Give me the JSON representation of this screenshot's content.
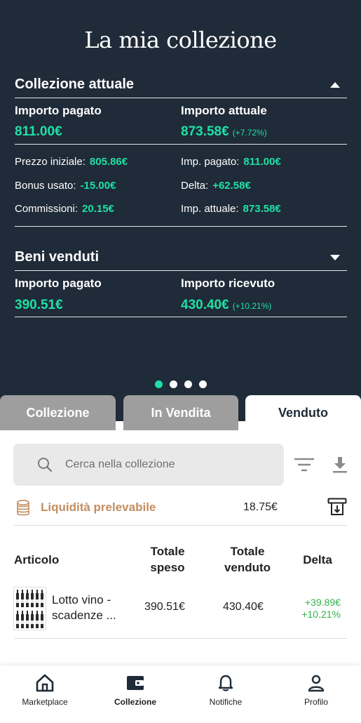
{
  "header": {
    "title": "La mia collezione"
  },
  "collezione_attuale": {
    "title": "Collezione attuale",
    "importo_pagato_label": "Importo pagato",
    "importo_pagato_value": "811.00€",
    "importo_attuale_label": "Importo attuale",
    "importo_attuale_value": "873.58€",
    "importo_attuale_pct": "(+7.72%)",
    "details": {
      "prezzo_iniziale_label": "Prezzo iniziale:",
      "prezzo_iniziale_value": "805.86€",
      "bonus_label": "Bonus usato:",
      "bonus_value": "-15.00€",
      "commissioni_label": "Commissioni:",
      "commissioni_value": "20.15€",
      "imp_pagato_label": "Imp. pagato:",
      "imp_pagato_value": "811.00€",
      "delta_label": "Delta:",
      "delta_value": "+62.58€",
      "imp_attuale_label": "Imp. attuale:",
      "imp_attuale_value": "873.58€"
    }
  },
  "beni_venduti": {
    "title": "Beni venduti",
    "importo_pagato_label": "Importo pagato",
    "importo_pagato_value": "390.51€",
    "importo_ricevuto_label": "Importo ricevuto",
    "importo_ricevuto_value": "430.40€",
    "importo_ricevuto_pct": "(+10.21%)"
  },
  "tabs": {
    "collezione": "Collezione",
    "in_vendita": "In Vendita",
    "venduto": "Venduto"
  },
  "search": {
    "placeholder": "Cerca nella collezione"
  },
  "liquidita": {
    "label": "Liquidità prelevabile",
    "amount": "18.75€"
  },
  "table": {
    "headers": {
      "articolo": "Articolo",
      "totale_speso": "Totale speso",
      "totale_venduto": "Totale venduto",
      "delta": "Delta"
    },
    "rows": [
      {
        "name": "Lotto vino - scadenze ...",
        "speso": "390.51€",
        "venduto": "430.40€",
        "delta_eur": "+39.89€",
        "delta_pct": "+10.21%"
      }
    ]
  },
  "bottom_nav": {
    "marketplace": "Marketplace",
    "collezione": "Collezione",
    "notifiche": "Notifiche",
    "profilo": "Profilo"
  },
  "colors": {
    "hero_bg": "#1f2b38",
    "accent_green": "#1fe0a5",
    "liquidity": "#c38e60",
    "delta_green": "#2fb44a"
  }
}
